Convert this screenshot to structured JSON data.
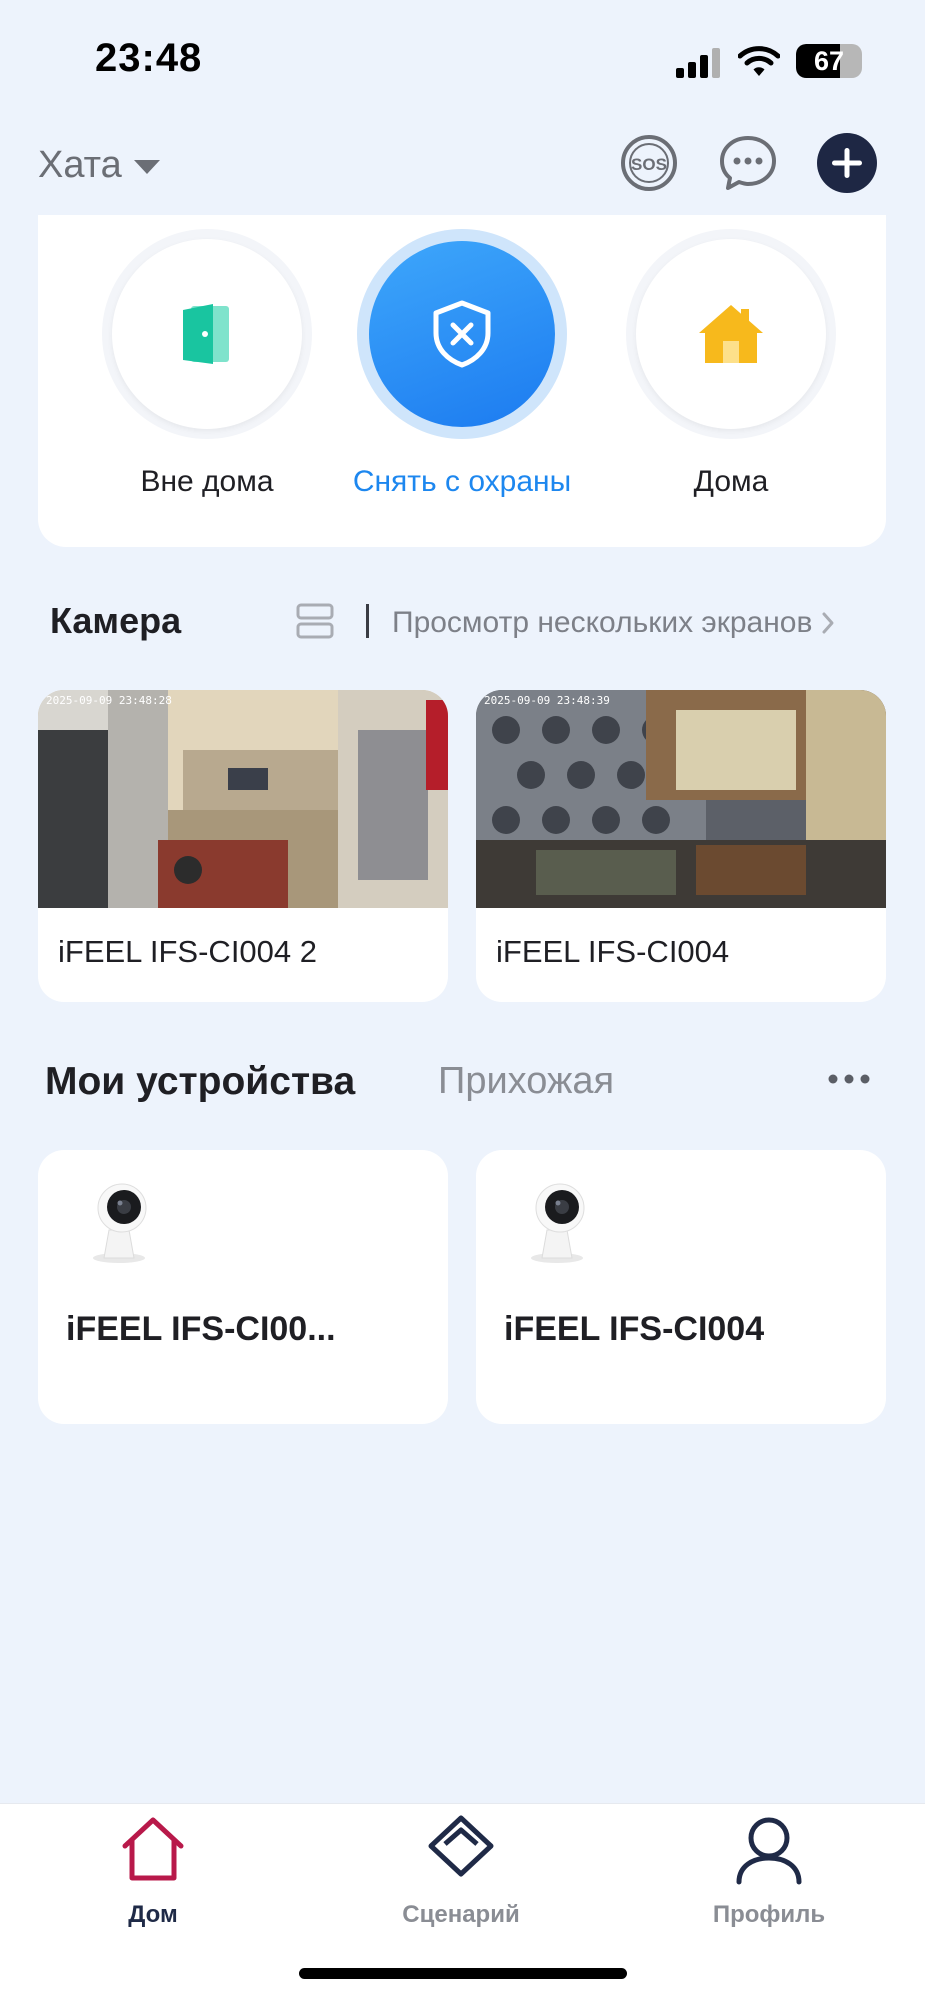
{
  "status_bar": {
    "time": "23:48",
    "battery": "67",
    "battery_level": 0.67
  },
  "header": {
    "home_name": "Хата",
    "sos_icon": "sos-icon",
    "chat_icon": "chat-bubble-icon",
    "add_icon": "plus-icon"
  },
  "modes": [
    {
      "label": "Вне дома",
      "icon": "door-exit-icon",
      "active": false
    },
    {
      "label": "Снять с охраны",
      "icon": "shield-x-icon",
      "active": true
    },
    {
      "label": "Дома",
      "icon": "house-icon",
      "active": false
    }
  ],
  "camera": {
    "title": "Камера",
    "multi_view_label": "Просмотр нескольких экранов",
    "cards": [
      {
        "name": "iFEEL IFS-CI004 2",
        "timestamp": "2025-09-09 23:48:28"
      },
      {
        "name": "iFEEL IFS-CI004",
        "timestamp": "2025-09-09 23:48:39"
      }
    ]
  },
  "devices": {
    "title": "Мои устройства",
    "room_tab": "Прихожая",
    "items": [
      {
        "name": "iFEEL IFS-CI00...",
        "icon": "camera-device-icon"
      },
      {
        "name": "iFEEL IFS-CI004",
        "icon": "camera-device-icon"
      }
    ]
  },
  "bottom_nav": [
    {
      "label": "Дом",
      "icon": "house-outline-icon",
      "active": true
    },
    {
      "label": "Сценарий",
      "icon": "layers-icon",
      "active": false
    },
    {
      "label": "Профиль",
      "icon": "user-icon",
      "active": false
    }
  ],
  "colors": {
    "background": "#edf3fc",
    "accent_blue": "#1d87ef",
    "nav_active_red": "#b8194a",
    "dark_navy": "#1e2744"
  }
}
